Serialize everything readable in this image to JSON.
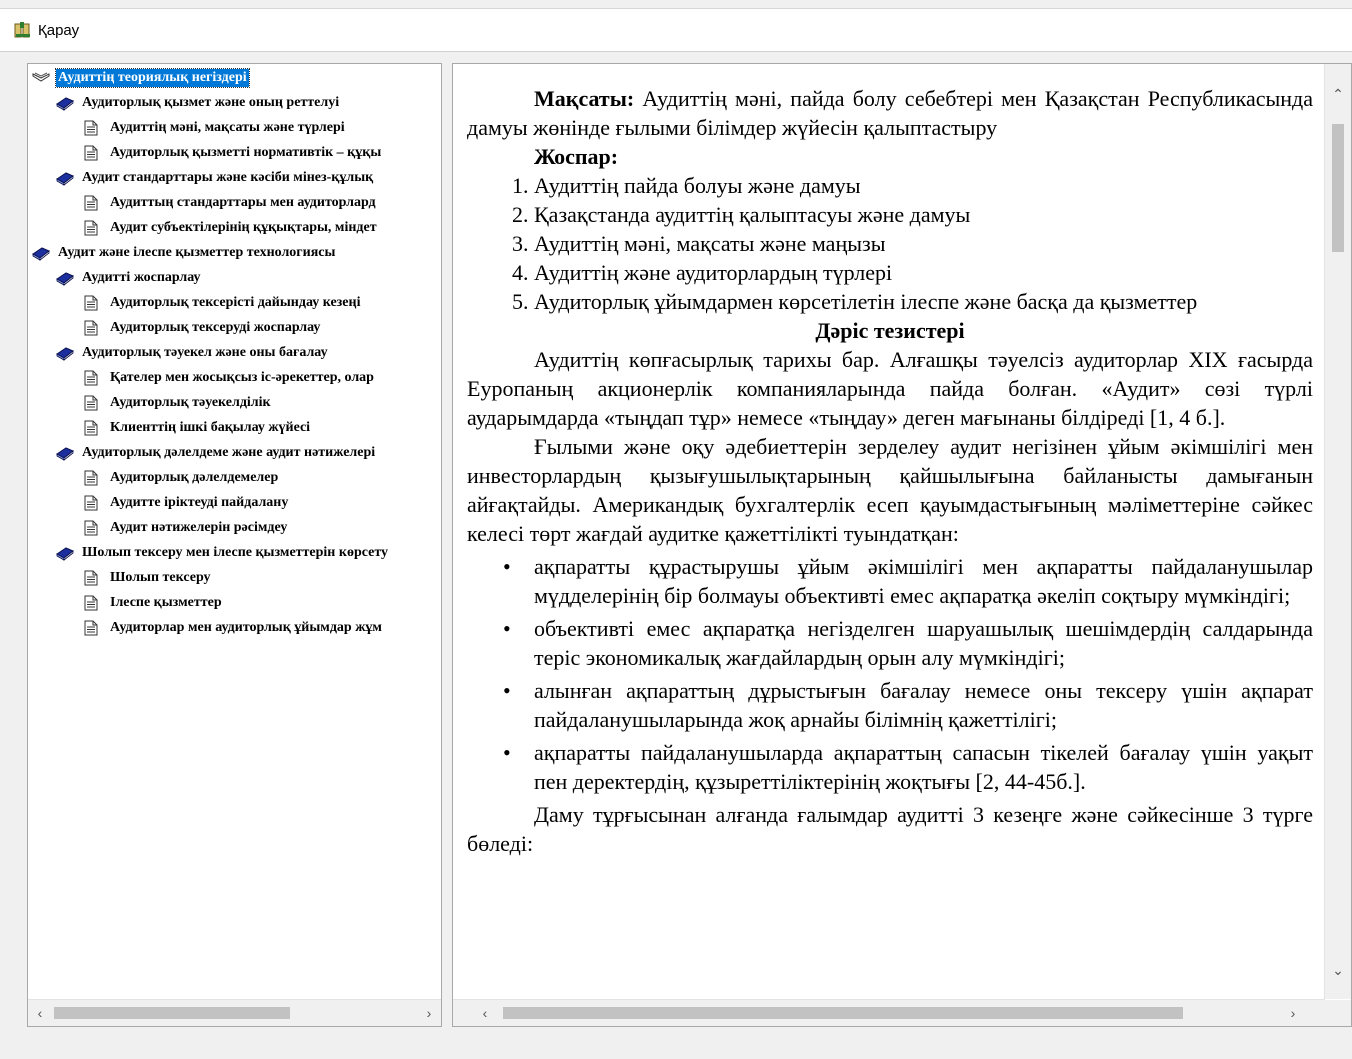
{
  "toolbar": {
    "view_label": "Қарау"
  },
  "tree": {
    "items": [
      {
        "label": "Аудиттің теориялық негіздері",
        "level": 0,
        "icon": "open-book-icon",
        "selected": true
      },
      {
        "label": "Аудиторлық қызмет және оның реттелуі",
        "level": 1,
        "icon": "book-icon"
      },
      {
        "label": "Аудиттің мәні, мақсаты  және түрлері",
        "level": 2,
        "icon": "document-icon"
      },
      {
        "label": "Аудиторлық қызметті нормативтік – құқы",
        "level": 2,
        "icon": "document-icon"
      },
      {
        "label": "Аудит стандарттары және кәсіби мінез-құлық",
        "level": 1,
        "icon": "book-icon"
      },
      {
        "label": "Аудиттың стандарттары мен аудиторлард",
        "level": 2,
        "icon": "document-icon"
      },
      {
        "label": "Аудит субъектілерінің құқықтары, міндет",
        "level": 2,
        "icon": "document-icon"
      },
      {
        "label": "Аудит  және ілеспе қызметтер технологиясы",
        "level": 0,
        "icon": "book-icon"
      },
      {
        "label": "Аудитті жоспарлау",
        "level": 1,
        "icon": "book-icon"
      },
      {
        "label": "Аудиторлық тексерісті дайындау кезеңі",
        "level": 2,
        "icon": "document-icon"
      },
      {
        "label": "Аудиторлық тексеруді жоспарлау",
        "level": 2,
        "icon": "document-icon"
      },
      {
        "label": "Аудиторлық тәуекел және оны бағалау",
        "level": 1,
        "icon": "book-icon"
      },
      {
        "label": "Қателер мен жосықсыз іс-әрекеттер, олар",
        "level": 2,
        "icon": "document-icon"
      },
      {
        "label": "Аудиторлық тәуекелділік",
        "level": 2,
        "icon": "document-icon"
      },
      {
        "label": "Клиенттің ішкі бақылау жүйесі",
        "level": 2,
        "icon": "document-icon"
      },
      {
        "label": "Аудиторлық дәлелдеме және аудит нәтижелері",
        "level": 1,
        "icon": "book-icon"
      },
      {
        "label": "Аудиторлық дәлелдемелер",
        "level": 2,
        "icon": "document-icon"
      },
      {
        "label": "Аудитте іріктеуді пайдалану",
        "level": 2,
        "icon": "document-icon"
      },
      {
        "label": "Аудит нәтижелерін рәсімдеу",
        "level": 2,
        "icon": "document-icon"
      },
      {
        "label": "Шолып тексеру мен ілеспе қызметтерін көрсету",
        "level": 1,
        "icon": "book-icon"
      },
      {
        "label": "Шолып тексеру",
        "level": 2,
        "icon": "document-icon"
      },
      {
        "label": "Ілеспе қызметтер",
        "level": 2,
        "icon": "document-icon"
      },
      {
        "label": "Аудиторлар мен аудиторлық ұйымдар жұм",
        "level": 2,
        "icon": "document-icon"
      }
    ]
  },
  "document": {
    "goal_label": "Мақсаты:",
    "goal_text": " Аудиттің мәні, пайда болу себебтері мен Қазақстан Республикасында дамуы жөнінде ғылыми білімдер жүйесін қалыптастыру",
    "plan_label": "Жоспар:",
    "plan_items": [
      "Аудиттің пайда болуы және дамуы",
      "Қазақстанда аудиттің қалыптасуы және дамуы",
      "Аудиттің мәні, мақсаты және маңызы",
      "Аудиттің және аудиторлардың түрлері",
      " Аудиторлық ұйымдармен көрсетілетін ілеспе және басқа да қызметтер"
    ],
    "theses_heading": "Дәріс тезистері",
    "para1": "Аудиттің көпғасырлық тарихы бар. Алғашқы тәуелсіз аудиторлар XIX ғасырда Еуропаның акционерлік компанияларында пайда болған. «Аудит» сөзі түрлі аударымдарда «тыңдап тұр» немесе «тыңдау» деген мағынаны білдіреді [1, 4 б.].",
    "para2": "Ғылыми және оқу әдебиеттерін зерделеу аудит негізінен ұйым әкімшілігі мен инвесторлардың қызығушылықтарының қайшылығына байланысты дамығанын айғақтайды. Американдық бухгалтерлік есеп қауымдастығының мәліметтеріне сәйкес келесі төрт жағдай аудитке қажеттілікті туындатқан:",
    "bullets": [
      " ақпаратты құрастырушы ұйым әкімшілігі мен ақпаратты пайдаланушылар мүдделерінің бір болмауы объективті емес ақпаратқа әкеліп соқтыру мүмкіндігі;",
      "объективті емес ақпаратқа негізделген шаруашылық шешімдердің салдарында теріс экономикалық жағдайлардың орын алу мүмкіндігі;",
      "алынған ақпараттың дұрыстығын бағалау немесе оны тексеру үшін ақпарат пайдаланушыларында жоқ арнайы білімнің қажеттілігі;",
      "ақпаратты пайдаланушыларда ақпараттың сапасын тікелей бағалау үшін уақыт пен деректердің, құзыреттіліктерінің жоқтығы [2, 44-45б.]."
    ],
    "para3": "Даму тұрғысынан алғанда ғалымдар аудитті 3 кезеңге және сәйкесінше 3 түрге бөледі:"
  }
}
